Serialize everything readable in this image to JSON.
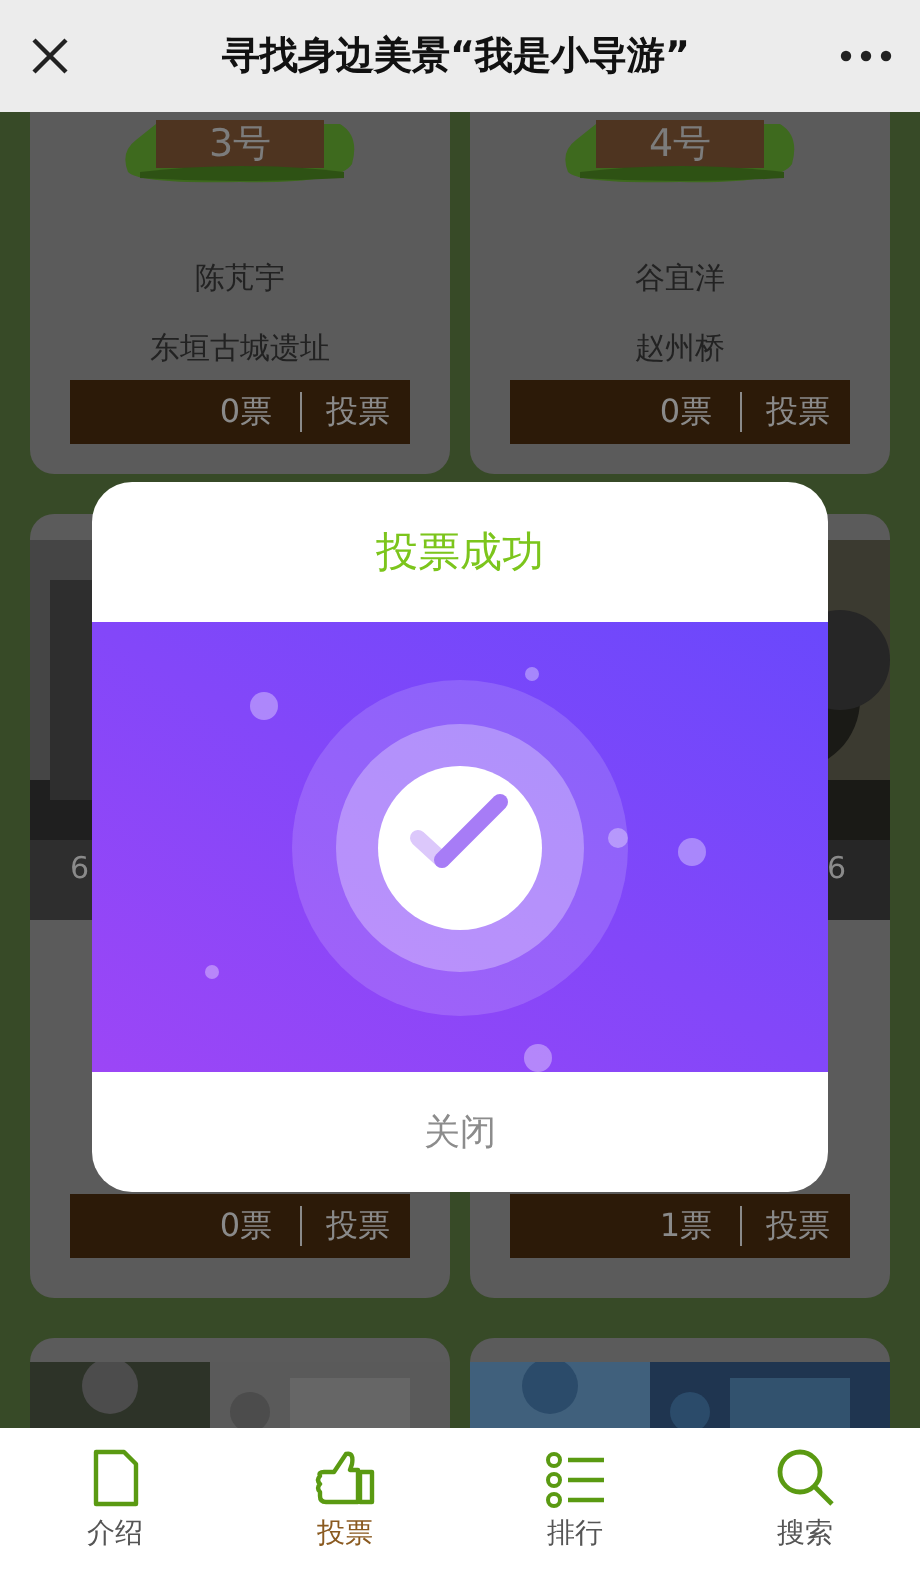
{
  "header": {
    "title": "寻找身边美景“我是小导游”"
  },
  "cards": [
    {
      "kind": "sign",
      "number": "3号",
      "name": "陈芃宇",
      "place": "东垣古城遗址",
      "votes": "0票",
      "action": "投票"
    },
    {
      "kind": "sign",
      "number": "4号",
      "name": "谷宜洋",
      "place": "赵州桥",
      "votes": "0票",
      "action": "投票"
    },
    {
      "caption": "6",
      "votes": "0票",
      "action": "投票"
    },
    {
      "caption": "6",
      "votes": "1票",
      "action": "投票"
    },
    {
      "kind": "photo-cut"
    },
    {
      "kind": "photo-cut"
    }
  ],
  "modal": {
    "title": "投票成功",
    "button": "关闭"
  },
  "tabs": [
    {
      "label": "介绍",
      "selected": false
    },
    {
      "label": "投票",
      "selected": true
    },
    {
      "label": "排行",
      "selected": false
    },
    {
      "label": "搜索",
      "selected": false
    }
  ]
}
